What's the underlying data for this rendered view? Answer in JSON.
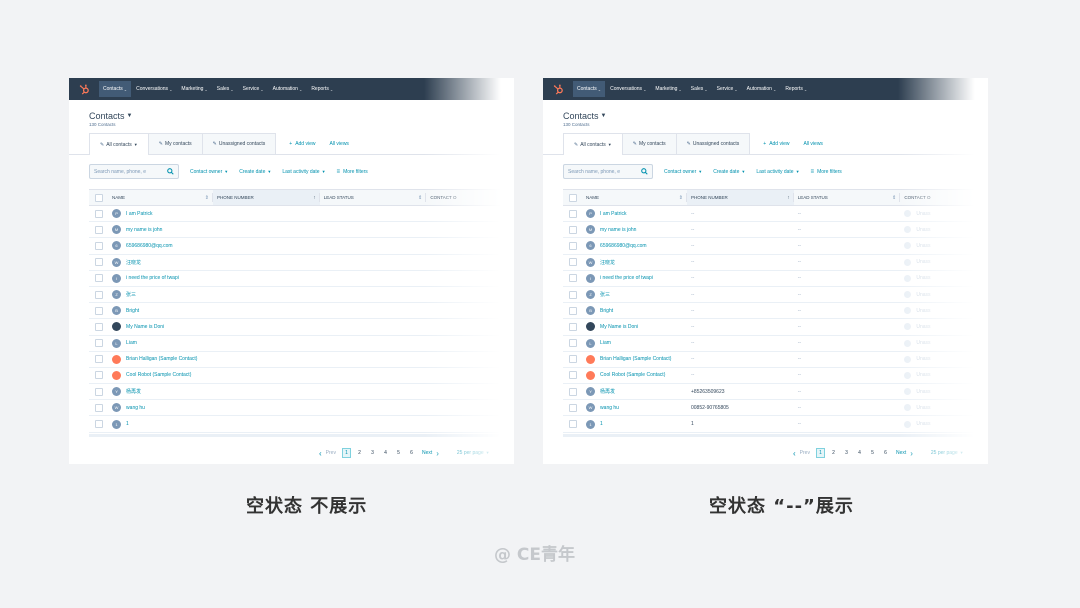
{
  "nav": [
    "Contacts",
    "Conversations",
    "Marketing",
    "Sales",
    "Service",
    "Automation",
    "Reports"
  ],
  "page_title": "Contacts",
  "contact_count": "130 Contacts",
  "tabs": [
    "All contacts",
    "My contacts",
    "Unassigned contacts"
  ],
  "tab_links": {
    "add_view": "Add view",
    "all_views": "All views"
  },
  "search_placeholder": "Search name, phone, e",
  "filters": [
    "Contact owner",
    "Create date",
    "Last activity date"
  ],
  "more_filters": "More filters",
  "columns": {
    "name": "NAME",
    "phone": "PHONE NUMBER",
    "lead": "LEAD STATUS",
    "contact": "CONTACT O"
  },
  "rows": [
    {
      "name": "I am Patrick",
      "initial": "P",
      "avatar": "default"
    },
    {
      "name": "my name is john",
      "initial": "M",
      "avatar": "default"
    },
    {
      "name": "659686980@qq.com",
      "initial": "6",
      "avatar": "default"
    },
    {
      "name": "汪晓龙",
      "initial": "W",
      "avatar": "default"
    },
    {
      "name": "i need the price of twapi",
      "initial": "I",
      "avatar": "default"
    },
    {
      "name": "张三",
      "initial": "Z",
      "avatar": "default"
    },
    {
      "name": "Bright",
      "initial": "B",
      "avatar": "default"
    },
    {
      "name": "My Name is Doni",
      "initial": "",
      "avatar": "dark"
    },
    {
      "name": "Liam",
      "initial": "L",
      "avatar": "default"
    },
    {
      "name": "Brian Halligan (Sample Contact)",
      "initial": "",
      "avatar": "hubspot"
    },
    {
      "name": "Cool Robot (Sample Contact)",
      "initial": "",
      "avatar": "hubspot"
    },
    {
      "name": "杨再发",
      "initial": "Y",
      "avatar": "default"
    },
    {
      "name": "wang hu",
      "initial": "W",
      "avatar": "default"
    },
    {
      "name": "1",
      "initial": "1",
      "avatar": "default"
    }
  ],
  "right_phones": [
    "--",
    "--",
    "--",
    "--",
    "--",
    "--",
    "--",
    "--",
    "--",
    "--",
    "--",
    "+85263509623",
    "00852-90765805",
    "1"
  ],
  "right_leads": [
    "--",
    "--",
    "--",
    "--",
    "--",
    "--",
    "--",
    "--",
    "--",
    "--",
    "--",
    "--",
    "--",
    "--"
  ],
  "right_owner": "Unass",
  "pagination": {
    "prev": "Prev",
    "pages": [
      "1",
      "2",
      "3",
      "4",
      "5",
      "6"
    ],
    "next": "Next",
    "per_page": "25 per page"
  },
  "captions": {
    "left": "空状态 不展示",
    "right": "空状态 “--”展示"
  },
  "watermark": "@ CE青年",
  "colors": {
    "nav_bg": "#2d3e50",
    "link": "#0091ae",
    "hubspot_orange": "#ff7a59",
    "page_bg": "#f2f3f5"
  }
}
